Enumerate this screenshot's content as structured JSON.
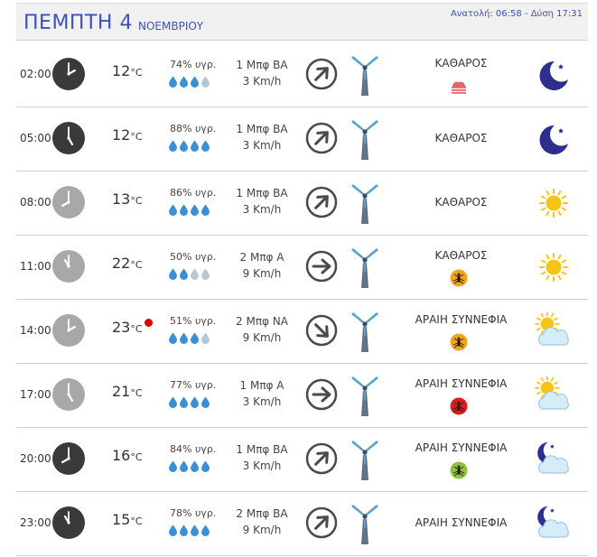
{
  "header": {
    "day": "ΠΕΜΠΤΗ 4",
    "month": "ΝΟΕΜΒΡΙΟΥ",
    "sun": "Ανατολή: 06:58 - Δύση 17:31"
  },
  "rows": [
    {
      "time": "02:00",
      "clock": "dark",
      "hour": 2,
      "temp": "12",
      "unit": "°C",
      "hot": false,
      "humidity": "74% υγρ.",
      "drops": 3,
      "wind_force": "1 Μπφ ΒΑ",
      "wind_speed": "3 Km/h",
      "wind_dir_deg": 225,
      "condition": "ΚΑΘΑΡΟΣ",
      "sub_icon": "haze-icon",
      "weather_icon": "moon-icon"
    },
    {
      "time": "05:00",
      "clock": "dark",
      "hour": 5,
      "temp": "12",
      "unit": "°C",
      "hot": false,
      "humidity": "88% υγρ.",
      "drops": 4,
      "wind_force": "1 Μπφ ΒΑ",
      "wind_speed": "3 Km/h",
      "wind_dir_deg": 225,
      "condition": "ΚΑΘΑΡΟΣ",
      "sub_icon": "",
      "weather_icon": "moon-icon"
    },
    {
      "time": "08:00",
      "clock": "light",
      "hour": 8,
      "temp": "13",
      "unit": "°C",
      "hot": false,
      "humidity": "86% υγρ.",
      "drops": 4,
      "wind_force": "1 Μπφ ΒΑ",
      "wind_speed": "3 Km/h",
      "wind_dir_deg": 225,
      "condition": "ΚΑΘΑΡΟΣ",
      "sub_icon": "",
      "weather_icon": "sun-icon"
    },
    {
      "time": "11:00",
      "clock": "light",
      "hour": 11,
      "temp": "22",
      "unit": "°C",
      "hot": false,
      "humidity": "50% υγρ.",
      "drops": 2,
      "wind_force": "2 Μπφ Α",
      "wind_speed": "9 Km/h",
      "wind_dir_deg": 270,
      "condition": "ΚΑΘΑΡΟΣ",
      "sub_icon": "mosquito-orange-icon",
      "weather_icon": "sun-icon"
    },
    {
      "time": "14:00",
      "clock": "light",
      "hour": 2,
      "temp": "23",
      "unit": "°C",
      "hot": true,
      "humidity": "51% υγρ.",
      "drops": 3,
      "wind_force": "2 Μπφ ΝΑ",
      "wind_speed": "9 Km/h",
      "wind_dir_deg": 315,
      "condition": "ΑΡΑΙΗ ΣΥΝΝΕΦΙΑ",
      "sub_icon": "mosquito-orange-icon",
      "weather_icon": "sun-cloud-icon"
    },
    {
      "time": "17:00",
      "clock": "light",
      "hour": 5,
      "temp": "21",
      "unit": "°C",
      "hot": false,
      "humidity": "77% υγρ.",
      "drops": 4,
      "wind_force": "1 Μπφ Α",
      "wind_speed": "3 Km/h",
      "wind_dir_deg": 270,
      "condition": "ΑΡΑΙΗ ΣΥΝΝΕΦΙΑ",
      "sub_icon": "mosquito-red-icon",
      "weather_icon": "sun-cloud-icon"
    },
    {
      "time": "20:00",
      "clock": "dark",
      "hour": 8,
      "temp": "16",
      "unit": "°C",
      "hot": false,
      "humidity": "84% υγρ.",
      "drops": 4,
      "wind_force": "1 Μπφ ΒΑ",
      "wind_speed": "3 Km/h",
      "wind_dir_deg": 225,
      "condition": "ΑΡΑΙΗ ΣΥΝΝΕΦΙΑ",
      "sub_icon": "mosquito-green-icon",
      "weather_icon": "moon-cloud-icon"
    },
    {
      "time": "23:00",
      "clock": "dark",
      "hour": 11,
      "temp": "15",
      "unit": "°C",
      "hot": false,
      "humidity": "78% υγρ.",
      "drops": 4,
      "wind_force": "2 Μπφ ΒΑ",
      "wind_speed": "9 Km/h",
      "wind_dir_deg": 225,
      "condition": "ΑΡΑΙΗ ΣΥΝΝΕΦΙΑ",
      "sub_icon": "",
      "weather_icon": "moon-cloud-icon"
    }
  ]
}
